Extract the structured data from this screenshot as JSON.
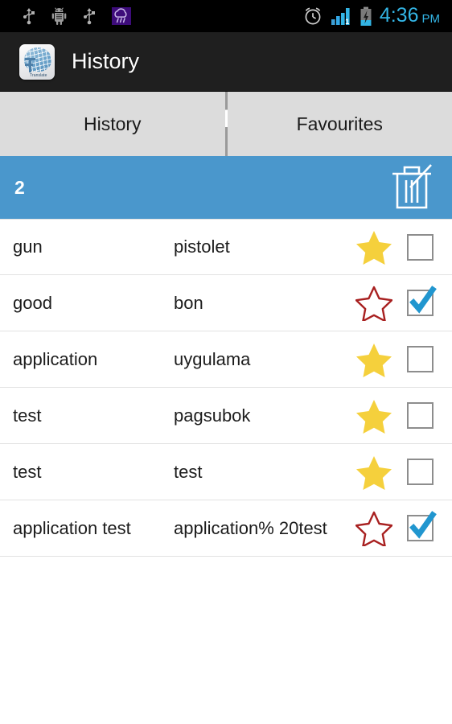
{
  "statusbar": {
    "icons": [
      "usb-icon",
      "android-debug-icon",
      "usb-icon",
      "weather-rain-icon"
    ],
    "alarm_icon": "alarm-clock-icon",
    "signal_icon": "signal-bars-icon",
    "signal_label": "1",
    "battery_icon": "battery-charging-icon",
    "time": "4:36",
    "ampm": "PM",
    "accent_color": "#33b5e5"
  },
  "actionbar": {
    "app_icon": "translate-globe-icon",
    "app_icon_word": "Translate",
    "title": "History",
    "background_color": "#1f1f1f"
  },
  "tabs": {
    "items": [
      {
        "label": "History",
        "selected": true
      },
      {
        "label": "Favourites",
        "selected": false
      }
    ],
    "background_color": "#dcdcdc"
  },
  "context_bar": {
    "selected_count": "2",
    "delete_icon": "trash-can-icon",
    "background_color": "#4a97cc"
  },
  "colors": {
    "star_filled": "#f5d03c",
    "star_outline": "#a82020",
    "checkbox_border": "#8d8d8d",
    "check_mark": "#2196cf",
    "row_divider": "#e2e2e2"
  },
  "list": {
    "rows": [
      {
        "source": "gun",
        "target": "pistolet",
        "favourite": true,
        "selected": false
      },
      {
        "source": "good",
        "target": "bon",
        "favourite": false,
        "selected": true
      },
      {
        "source": "application",
        "target": "uygulama",
        "favourite": true,
        "selected": false
      },
      {
        "source": "test",
        "target": "pagsubok",
        "favourite": true,
        "selected": false
      },
      {
        "source": "test",
        "target": "test",
        "favourite": true,
        "selected": false
      },
      {
        "source": "application test",
        "target": "application% 20test",
        "favourite": false,
        "selected": true
      }
    ]
  }
}
